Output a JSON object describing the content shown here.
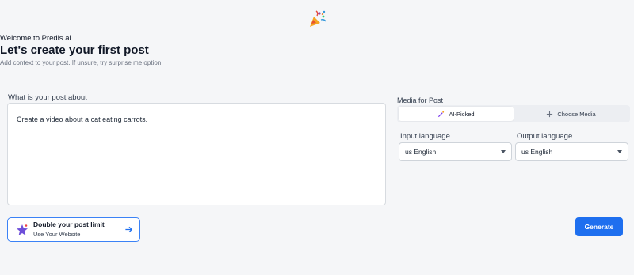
{
  "header": {
    "welcome": "Welcome to Predis.ai",
    "title": "Let's create your first post",
    "subtitle": "Add context to your post. If unsure, try surprise me option.",
    "icon": "party-popper-icon"
  },
  "post": {
    "label": "What is your post about",
    "value": "Create a video about a cat eating carrots."
  },
  "media": {
    "label": "Media for Post",
    "options": [
      {
        "label": "AI-Picked",
        "icon": "magic-wand-icon",
        "selected": true
      },
      {
        "label": "Choose Media",
        "icon": "plus-icon",
        "selected": false
      }
    ]
  },
  "input_language": {
    "label": "Input language",
    "value": "us English"
  },
  "output_language": {
    "label": "Output language",
    "value": "us English"
  },
  "promo": {
    "title": "Double your post limit",
    "subtitle": "Use Your Website",
    "icon": "star-badge-icon",
    "arrow_icon": "arrow-right-icon"
  },
  "actions": {
    "generate_label": "Generate"
  },
  "colors": {
    "primary": "#1e6fef",
    "promo_border": "#3b82f6",
    "background": "#f5f6f8"
  }
}
